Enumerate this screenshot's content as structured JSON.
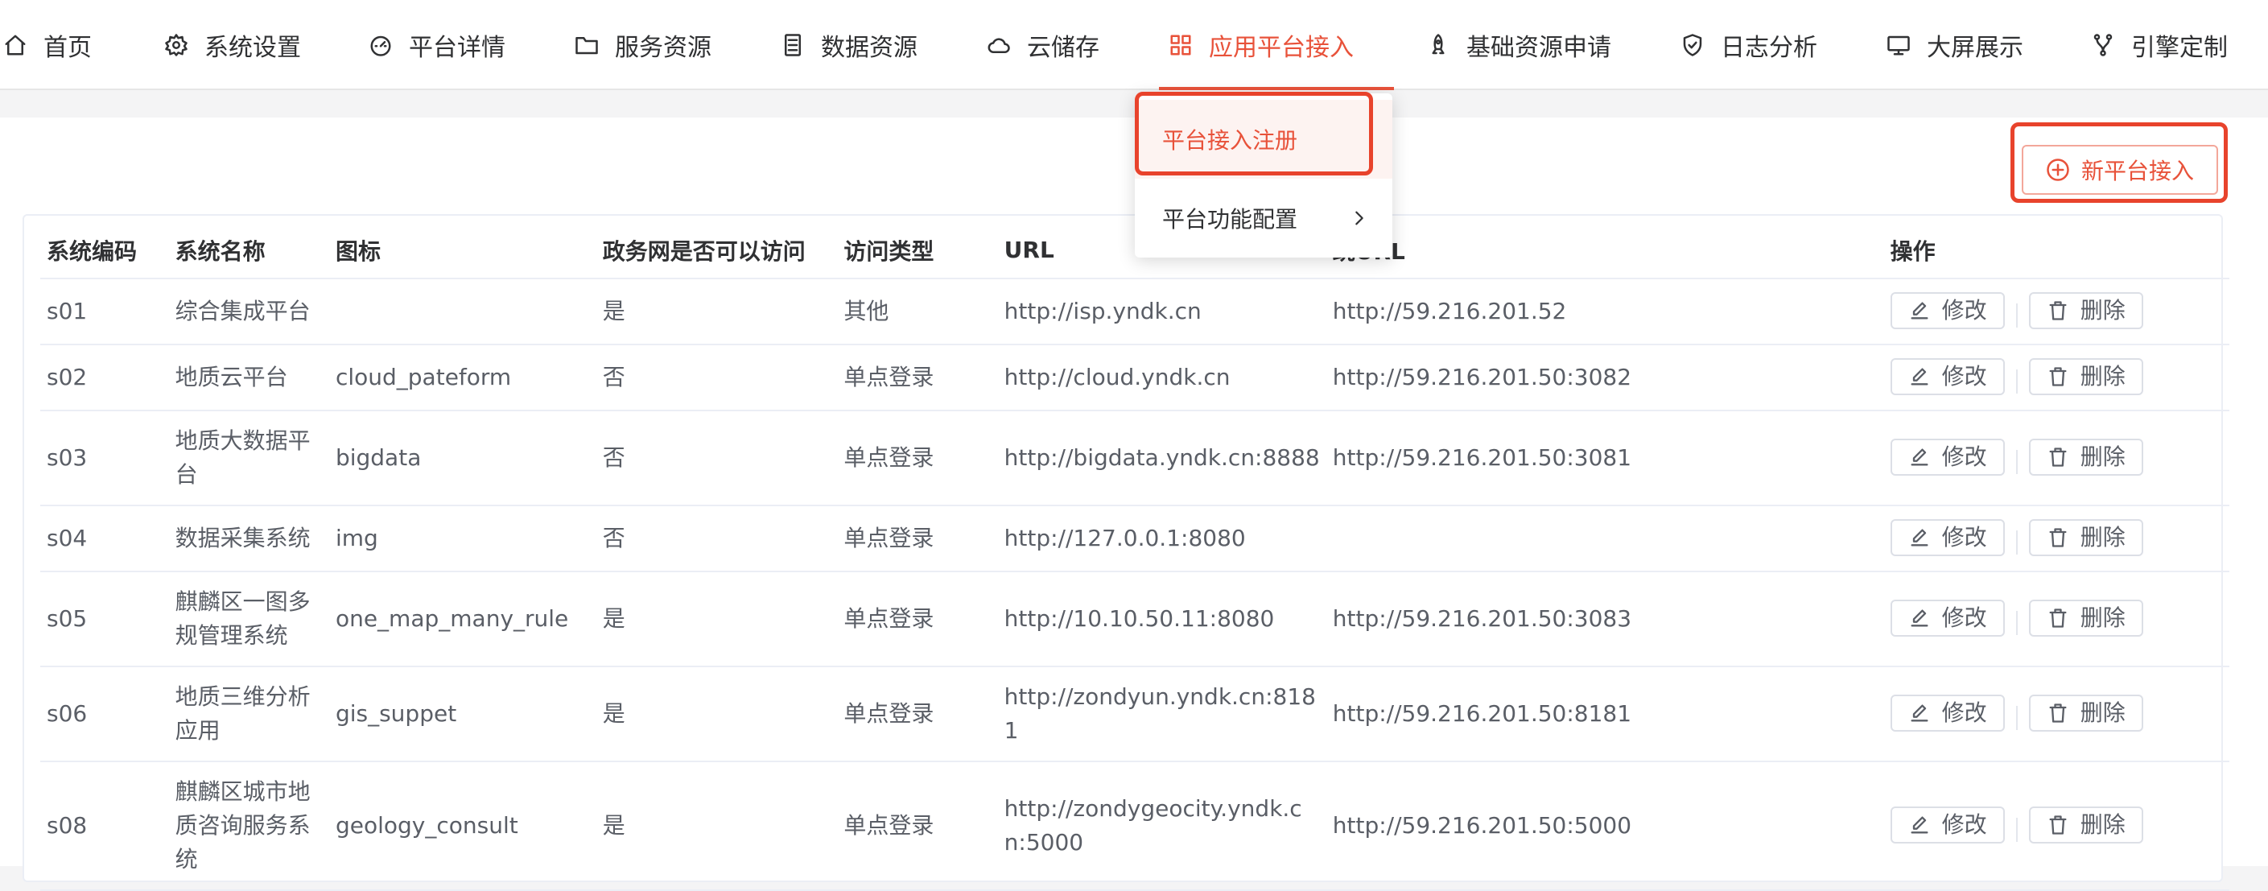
{
  "nav": {
    "items": [
      {
        "label": "首页",
        "icon": "home-icon"
      },
      {
        "label": "系统设置",
        "icon": "gear-icon"
      },
      {
        "label": "平台详情",
        "icon": "dashboard-icon"
      },
      {
        "label": "服务资源",
        "icon": "folder-icon"
      },
      {
        "label": "数据资源",
        "icon": "document-icon"
      },
      {
        "label": "云储存",
        "icon": "cloud-icon"
      },
      {
        "label": "应用平台接入",
        "icon": "grid-icon",
        "active": true
      },
      {
        "label": "基础资源申请",
        "icon": "rocket-icon"
      },
      {
        "label": "日志分析",
        "icon": "shield-icon"
      },
      {
        "label": "大屏展示",
        "icon": "monitor-icon"
      },
      {
        "label": "引擎定制",
        "icon": "branch-icon"
      }
    ],
    "active_color": "#e8523a"
  },
  "dropdown": {
    "items": [
      {
        "label": "平台接入注册",
        "active": true
      },
      {
        "label": "平台功能配置",
        "has_submenu": true
      }
    ]
  },
  "toolbar": {
    "new_button_label": "新平台接入"
  },
  "table": {
    "columns": [
      "系统编码",
      "系统名称",
      "图标",
      "政务网是否可以访问",
      "访问类型",
      "URL",
      "跳URL",
      "操作"
    ],
    "rows": [
      {
        "code": "s01",
        "name": "综合集成平台",
        "icon": "",
        "gov": "是",
        "type": "其他",
        "url": "http://isp.yndk.cn",
        "jump": "http://59.216.201.52"
      },
      {
        "code": "s02",
        "name": "地质云平台",
        "icon": "cloud_pateform",
        "gov": "否",
        "type": "单点登录",
        "url": "http://cloud.yndk.cn",
        "jump": "http://59.216.201.50:3082"
      },
      {
        "code": "s03",
        "name": "地质大数据平台",
        "icon": "bigdata",
        "gov": "否",
        "type": "单点登录",
        "url": "http://bigdata.yndk.cn:8888",
        "jump": "http://59.216.201.50:3081"
      },
      {
        "code": "s04",
        "name": "数据采集系统",
        "icon": "img",
        "gov": "否",
        "type": "单点登录",
        "url": "http://127.0.0.1:8080",
        "jump": ""
      },
      {
        "code": "s05",
        "name": "麒麟区一图多规管理系统",
        "icon": "one_map_many_rule",
        "gov": "是",
        "type": "单点登录",
        "url": "http://10.10.50.11:8080",
        "jump": "http://59.216.201.50:3083"
      },
      {
        "code": "s06",
        "name": "地质三维分析应用",
        "icon": "gis_suppet",
        "gov": "是",
        "type": "单点登录",
        "url": "http://zondyun.yndk.cn:8181",
        "jump": "http://59.216.201.50:8181"
      },
      {
        "code": "s08",
        "name": "麒麟区城市地质咨询服务系统",
        "icon": "geology_consult",
        "gov": "是",
        "type": "单点登录",
        "url": "http://zondygeocity.yndk.cn:5000",
        "jump": "http://59.216.201.50:5000"
      }
    ],
    "edit_label": "修改",
    "delete_label": "删除"
  }
}
